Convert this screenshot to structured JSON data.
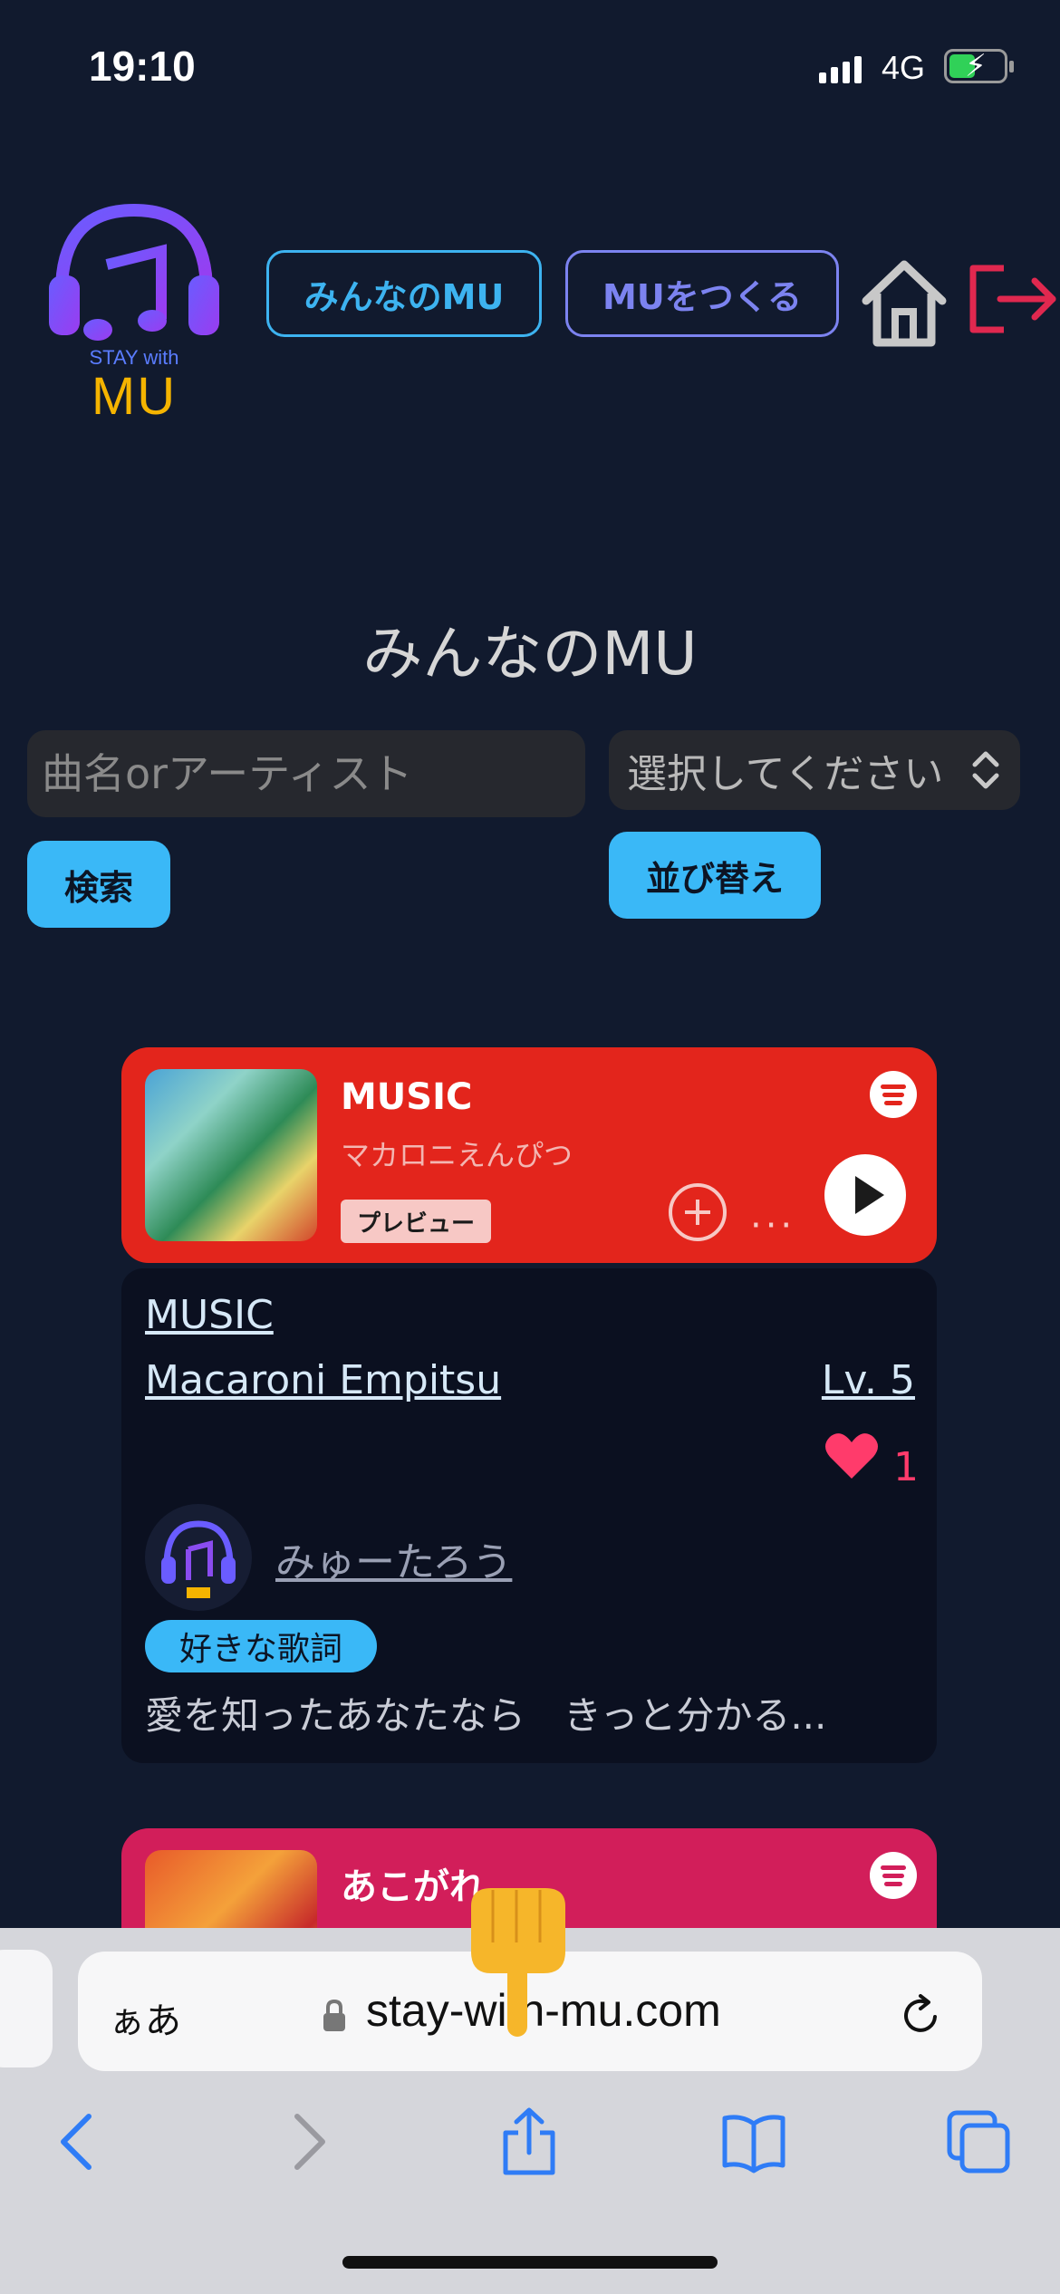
{
  "status_bar": {
    "time": "19:10",
    "network": "4G"
  },
  "logo": {
    "line1": "STAY with",
    "line2": "MU"
  },
  "nav": {
    "everyone_label": "みんなのMU",
    "create_label": "MUをつくる"
  },
  "page": {
    "title": "みんなのMU"
  },
  "search": {
    "placeholder": "曲名orアーティスト",
    "button_label": "検索"
  },
  "sort": {
    "selected": "選択してください",
    "button_label": "並び替え"
  },
  "posts": [
    {
      "song": "MUSIC",
      "artist_jp": "マカロニえんぴつ",
      "preview_label": "プレビュー",
      "song_link": "MUSIC",
      "artist_link": "Macaroni Empitsu",
      "level": "Lv. 5",
      "likes": "1",
      "user": "みゅーたろう",
      "lyric_label": "好きな歌詞",
      "lyric": "愛を知ったあなたなら　きっと分かる..."
    },
    {
      "song": "あこがれ"
    }
  ],
  "browser": {
    "aa_label": "ぁあ",
    "url": "stay-with-mu.com"
  },
  "colors": {
    "accent_blue": "#3ab8f7",
    "accent_purple": "#7c83f0",
    "card_red": "#e3251c",
    "card_pink": "#d21e5a",
    "heart": "#ff3b6b",
    "logout": "#e0284f"
  },
  "icons": [
    "home-icon",
    "logout-icon",
    "spotify-icon",
    "add-icon",
    "more-icon",
    "play-icon",
    "heart-icon",
    "lock-icon",
    "reload-icon",
    "back-icon",
    "forward-icon",
    "share-icon",
    "bookmarks-icon",
    "tabs-icon"
  ]
}
